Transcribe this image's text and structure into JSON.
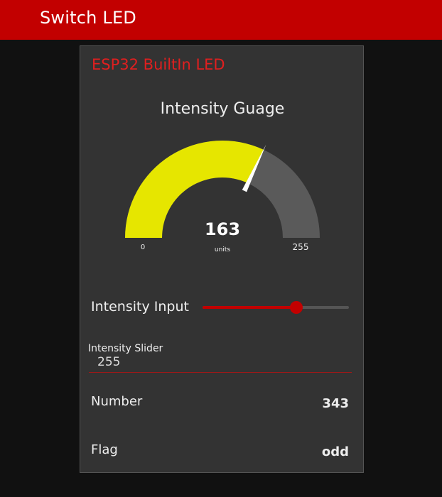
{
  "header": {
    "title": "Switch LED"
  },
  "card": {
    "title": "ESP32 BuiltIn LED",
    "accent_color": "#e01f1f"
  },
  "gauge": {
    "title": "Intensity Guage",
    "value": 163,
    "value_text": "163",
    "units": "units",
    "min": 0,
    "max": 255,
    "min_label": "0",
    "max_label": "255",
    "fill_color": "#e6e600",
    "track_color": "#5a5a5a",
    "needle_color": "#ffffff"
  },
  "slider": {
    "label": "Intensity Input",
    "value": 163,
    "min": 0,
    "max": 255,
    "color": "#c20000"
  },
  "text_input": {
    "label": "Intensity Slider",
    "value": "255"
  },
  "rows": [
    {
      "label": "Number",
      "value": "343"
    },
    {
      "label": "Flag",
      "value": "odd"
    }
  ]
}
